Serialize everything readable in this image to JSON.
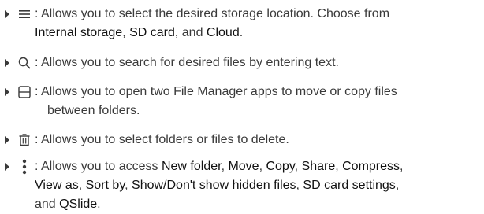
{
  "items": [
    {
      "icon": "menu-lines-icon",
      "line1": ": Allows you to select the desired storage location. Choose from",
      "line2_parts": [
        "Internal storage",
        ", ",
        "SD card,",
        " and ",
        "Cloud",
        "."
      ]
    },
    {
      "icon": "search-icon",
      "line1": ": Allows you to search for desired files by entering text."
    },
    {
      "icon": "split-view-icon",
      "line1": ": Allows you to open two File Manager apps to move or copy files",
      "line2": "between folders."
    },
    {
      "icon": "trash-icon",
      "line1": ": Allows you to select folders or files to delete."
    },
    {
      "icon": "more-vertical-icon",
      "line1_prefix": ": Allows you to access ",
      "line1_terms": [
        "New folder",
        ", ",
        "Move",
        ", ",
        "Copy",
        ", ",
        "Share",
        ", ",
        "Compress",
        ","
      ],
      "line2_terms": [
        "View as",
        ", ",
        "Sort by",
        ", ",
        "Show/Don't show hidden files",
        ", ",
        "SD card settings",
        ","
      ],
      "line3_parts": [
        "and ",
        "QSlide",
        "."
      ]
    }
  ]
}
